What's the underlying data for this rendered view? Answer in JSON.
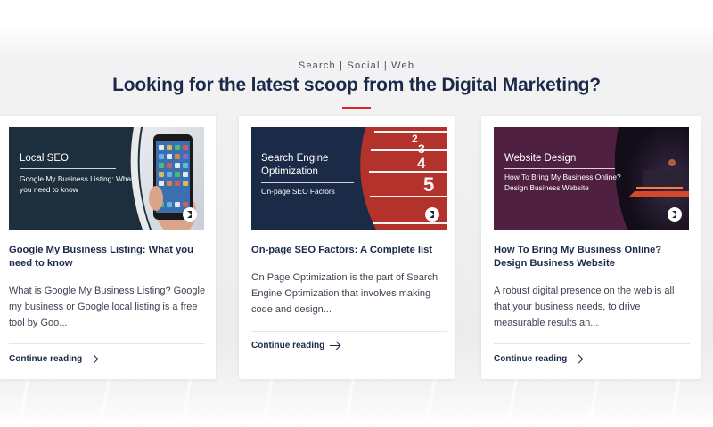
{
  "header": {
    "kicker": "Search | Social | Web",
    "headline": "Looking for the latest scoop from the Digital Marketing?"
  },
  "colors": {
    "accent": "#e0242f",
    "navy": "#1b2a4a",
    "thumb_dark_teal": "#1d2f3c",
    "thumb_navy": "#1b2a46",
    "thumb_plum": "#4f2040"
  },
  "cards": [
    {
      "thumb_title": "Local SEO",
      "thumb_sub": "Google My Business Listing: What you need to know",
      "title": "Google My Business Listing: What you need to know",
      "excerpt": "What is Google My Business Listing? Google my business or Google local listing is a free tool by Goo...",
      "cta": "Continue reading"
    },
    {
      "thumb_title": "Search Engine Optimization",
      "thumb_sub": "On-page SEO Factors",
      "track_numbers": [
        "2",
        "3",
        "4",
        "5"
      ],
      "title": "On-page SEO Factors: A Complete list",
      "excerpt": "On Page Optimization is the part of Search Engine Optimization that involves making code and design...",
      "cta": "Continue reading"
    },
    {
      "thumb_title": "Website Design",
      "thumb_sub": "How To Bring My Business Online? Design Business Website",
      "title": "How To Bring My Business Online? Design Business Website",
      "excerpt": "A robust digital presence on the web is all that your business needs, to drive measurable results an...",
      "cta": "Continue reading"
    }
  ],
  "icons": [
    "brand-play-icon",
    "arrow-right-icon",
    "smartphone-image",
    "running-track-image",
    "laptop-image"
  ]
}
